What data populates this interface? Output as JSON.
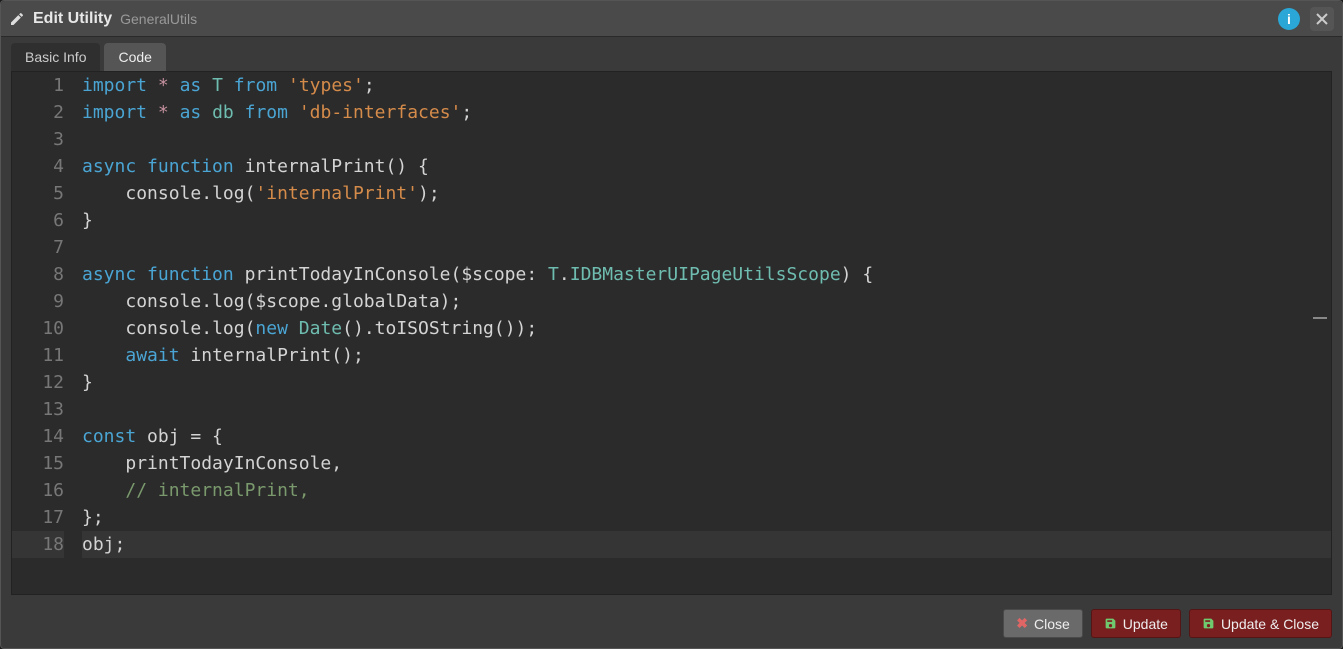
{
  "titlebar": {
    "title": "Edit Utility",
    "subtitle": "GeneralUtils"
  },
  "tabs": [
    {
      "label": "Basic Info",
      "active": false
    },
    {
      "label": "Code",
      "active": true
    }
  ],
  "code": {
    "lines": [
      {
        "n": 1,
        "tokens": [
          {
            "t": "import",
            "c": "kw"
          },
          {
            "t": " ",
            "c": ""
          },
          {
            "t": "*",
            "c": "star"
          },
          {
            "t": " ",
            "c": ""
          },
          {
            "t": "as",
            "c": "kw"
          },
          {
            "t": " ",
            "c": ""
          },
          {
            "t": "T",
            "c": "ns"
          },
          {
            "t": " ",
            "c": ""
          },
          {
            "t": "from",
            "c": "kw"
          },
          {
            "t": " ",
            "c": ""
          },
          {
            "t": "'types'",
            "c": "str"
          },
          {
            "t": ";",
            "c": "punc"
          }
        ]
      },
      {
        "n": 2,
        "tokens": [
          {
            "t": "import",
            "c": "kw"
          },
          {
            "t": " ",
            "c": ""
          },
          {
            "t": "*",
            "c": "star"
          },
          {
            "t": " ",
            "c": ""
          },
          {
            "t": "as",
            "c": "kw"
          },
          {
            "t": " ",
            "c": ""
          },
          {
            "t": "db",
            "c": "ns"
          },
          {
            "t": " ",
            "c": ""
          },
          {
            "t": "from",
            "c": "kw"
          },
          {
            "t": " ",
            "c": ""
          },
          {
            "t": "'db-interfaces'",
            "c": "str"
          },
          {
            "t": ";",
            "c": "punc"
          }
        ]
      },
      {
        "n": 3,
        "tokens": []
      },
      {
        "n": 4,
        "tokens": [
          {
            "t": "async",
            "c": "kw"
          },
          {
            "t": " ",
            "c": ""
          },
          {
            "t": "function",
            "c": "kw"
          },
          {
            "t": " ",
            "c": ""
          },
          {
            "t": "internalPrint",
            "c": "fn"
          },
          {
            "t": "() {",
            "c": "punc"
          }
        ]
      },
      {
        "n": 5,
        "tokens": [
          {
            "t": "    ",
            "c": ""
          },
          {
            "t": "console",
            "c": "id"
          },
          {
            "t": ".",
            "c": "punc"
          },
          {
            "t": "log",
            "c": "call"
          },
          {
            "t": "(",
            "c": "punc"
          },
          {
            "t": "'internalPrint'",
            "c": "str"
          },
          {
            "t": ");",
            "c": "punc"
          }
        ]
      },
      {
        "n": 6,
        "tokens": [
          {
            "t": "}",
            "c": "punc"
          }
        ]
      },
      {
        "n": 7,
        "tokens": []
      },
      {
        "n": 8,
        "tokens": [
          {
            "t": "async",
            "c": "kw"
          },
          {
            "t": " ",
            "c": ""
          },
          {
            "t": "function",
            "c": "kw"
          },
          {
            "t": " ",
            "c": ""
          },
          {
            "t": "printTodayInConsole",
            "c": "fn"
          },
          {
            "t": "(",
            "c": "punc"
          },
          {
            "t": "$scope",
            "c": "id"
          },
          {
            "t": ": ",
            "c": "punc"
          },
          {
            "t": "T",
            "c": "ns"
          },
          {
            "t": ".",
            "c": "punc"
          },
          {
            "t": "IDBMasterUIPageUtilsScope",
            "c": "type"
          },
          {
            "t": ") {",
            "c": "punc"
          }
        ]
      },
      {
        "n": 9,
        "tokens": [
          {
            "t": "    ",
            "c": ""
          },
          {
            "t": "console",
            "c": "id"
          },
          {
            "t": ".",
            "c": "punc"
          },
          {
            "t": "log",
            "c": "call"
          },
          {
            "t": "(",
            "c": "punc"
          },
          {
            "t": "$scope",
            "c": "id"
          },
          {
            "t": ".",
            "c": "punc"
          },
          {
            "t": "globalData",
            "c": "id"
          },
          {
            "t": ");",
            "c": "punc"
          }
        ]
      },
      {
        "n": 10,
        "tokens": [
          {
            "t": "    ",
            "c": ""
          },
          {
            "t": "console",
            "c": "id"
          },
          {
            "t": ".",
            "c": "punc"
          },
          {
            "t": "log",
            "c": "call"
          },
          {
            "t": "(",
            "c": "punc"
          },
          {
            "t": "new",
            "c": "kw"
          },
          {
            "t": " ",
            "c": ""
          },
          {
            "t": "Date",
            "c": "cls"
          },
          {
            "t": "().",
            "c": "punc"
          },
          {
            "t": "toISOString",
            "c": "call"
          },
          {
            "t": "());",
            "c": "punc"
          }
        ]
      },
      {
        "n": 11,
        "tokens": [
          {
            "t": "    ",
            "c": ""
          },
          {
            "t": "await",
            "c": "kw"
          },
          {
            "t": " ",
            "c": ""
          },
          {
            "t": "internalPrint",
            "c": "call"
          },
          {
            "t": "();",
            "c": "punc"
          }
        ]
      },
      {
        "n": 12,
        "tokens": [
          {
            "t": "}",
            "c": "punc"
          }
        ]
      },
      {
        "n": 13,
        "tokens": []
      },
      {
        "n": 14,
        "tokens": [
          {
            "t": "const",
            "c": "kw"
          },
          {
            "t": " ",
            "c": ""
          },
          {
            "t": "obj",
            "c": "id"
          },
          {
            "t": " = {",
            "c": "punc"
          }
        ]
      },
      {
        "n": 15,
        "tokens": [
          {
            "t": "    ",
            "c": ""
          },
          {
            "t": "printTodayInConsole",
            "c": "id"
          },
          {
            "t": ",",
            "c": "punc"
          }
        ]
      },
      {
        "n": 16,
        "tokens": [
          {
            "t": "    ",
            "c": ""
          },
          {
            "t": "// internalPrint,",
            "c": "cmt"
          }
        ]
      },
      {
        "n": 17,
        "tokens": [
          {
            "t": "};",
            "c": "punc"
          }
        ]
      },
      {
        "n": 18,
        "hl": true,
        "tokens": [
          {
            "t": "obj",
            "c": "id"
          },
          {
            "t": ";",
            "c": "punc"
          }
        ]
      }
    ]
  },
  "footer": {
    "close": "Close",
    "update": "Update",
    "update_close": "Update & Close"
  }
}
